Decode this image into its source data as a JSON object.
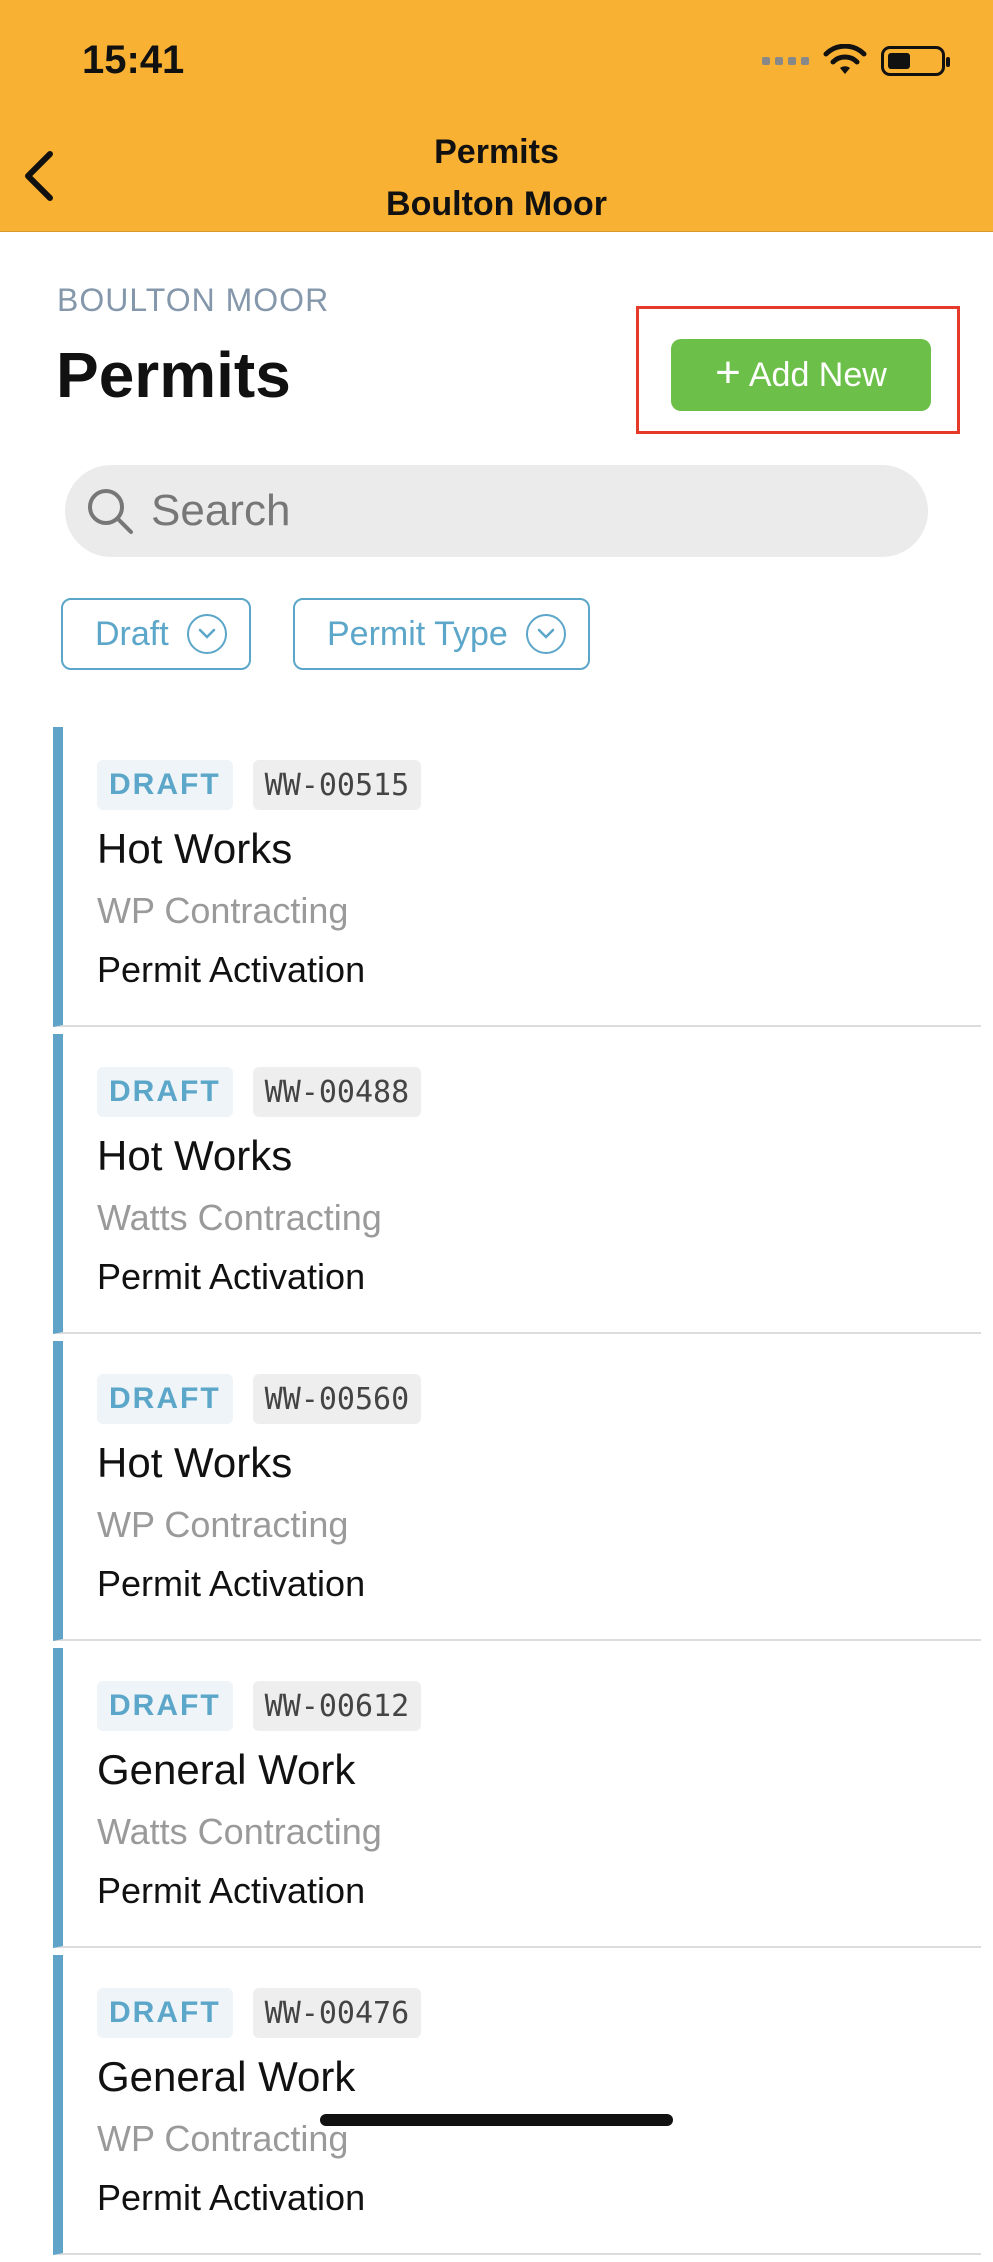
{
  "status_bar": {
    "time": "15:41"
  },
  "nav": {
    "title": "Permits",
    "subtitle": "Boulton Moor"
  },
  "page": {
    "eyebrow": "BOULTON MOOR",
    "title": "Permits",
    "add_button_label": "Add New"
  },
  "search": {
    "placeholder": "Search",
    "value": ""
  },
  "filters": [
    {
      "label": "Draft"
    },
    {
      "label": "Permit Type"
    }
  ],
  "permits": [
    {
      "status": "DRAFT",
      "id": "WW-00515",
      "title": "Hot Works",
      "company": "WP Contracting",
      "activity": "Permit Activation"
    },
    {
      "status": "DRAFT",
      "id": "WW-00488",
      "title": "Hot Works",
      "company": "Watts Contracting",
      "activity": "Permit Activation"
    },
    {
      "status": "DRAFT",
      "id": "WW-00560",
      "title": "Hot Works",
      "company": "WP Contracting",
      "activity": "Permit Activation"
    },
    {
      "status": "DRAFT",
      "id": "WW-00612",
      "title": "General Work",
      "company": "Watts Contracting",
      "activity": "Permit Activation"
    },
    {
      "status": "DRAFT",
      "id": "WW-00476",
      "title": "General Work",
      "company": "WP Contracting",
      "activity": "Permit Activation"
    }
  ],
  "colors": {
    "header": "#F8B133",
    "accent": "#5BA6C9",
    "add_button": "#6CC04A",
    "highlight": "#E5392A"
  }
}
